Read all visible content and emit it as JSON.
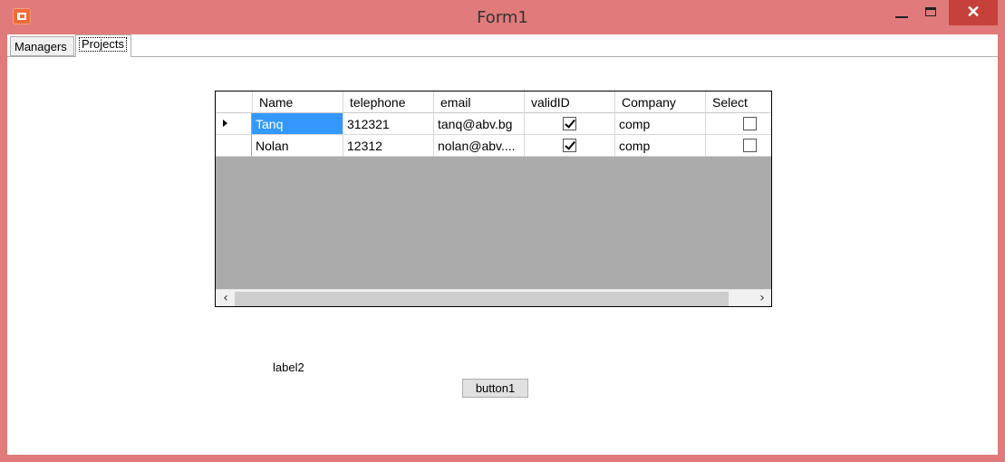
{
  "window": {
    "title": "Form1"
  },
  "tabs": [
    {
      "label": "Managers"
    },
    {
      "label": "Projects"
    }
  ],
  "grid": {
    "columns": [
      "Name",
      "telephone",
      "email",
      "validID",
      "Company",
      "Select"
    ],
    "rows": [
      {
        "name": "Tanq",
        "telephone": "312321",
        "email": "tanq@abv.bg",
        "validID": true,
        "company": "comp",
        "select": false,
        "current": true
      },
      {
        "name": "Nolan",
        "telephone": "12312",
        "email": "nolan@abv....",
        "validID": true,
        "company": "comp",
        "select": false,
        "current": false
      }
    ],
    "scroll_left_glyph": "‹",
    "scroll_right_glyph": "›"
  },
  "label2": "label2",
  "button1": "button1",
  "icons": {
    "app": "app-icon",
    "minimize": "minimize-icon",
    "maximize": "maximize-icon",
    "close": "close-icon"
  },
  "colors": {
    "titlebar": "#e07a7b",
    "close_button": "#c6413b",
    "selection": "#3399ff",
    "grid_background": "#ababab"
  }
}
